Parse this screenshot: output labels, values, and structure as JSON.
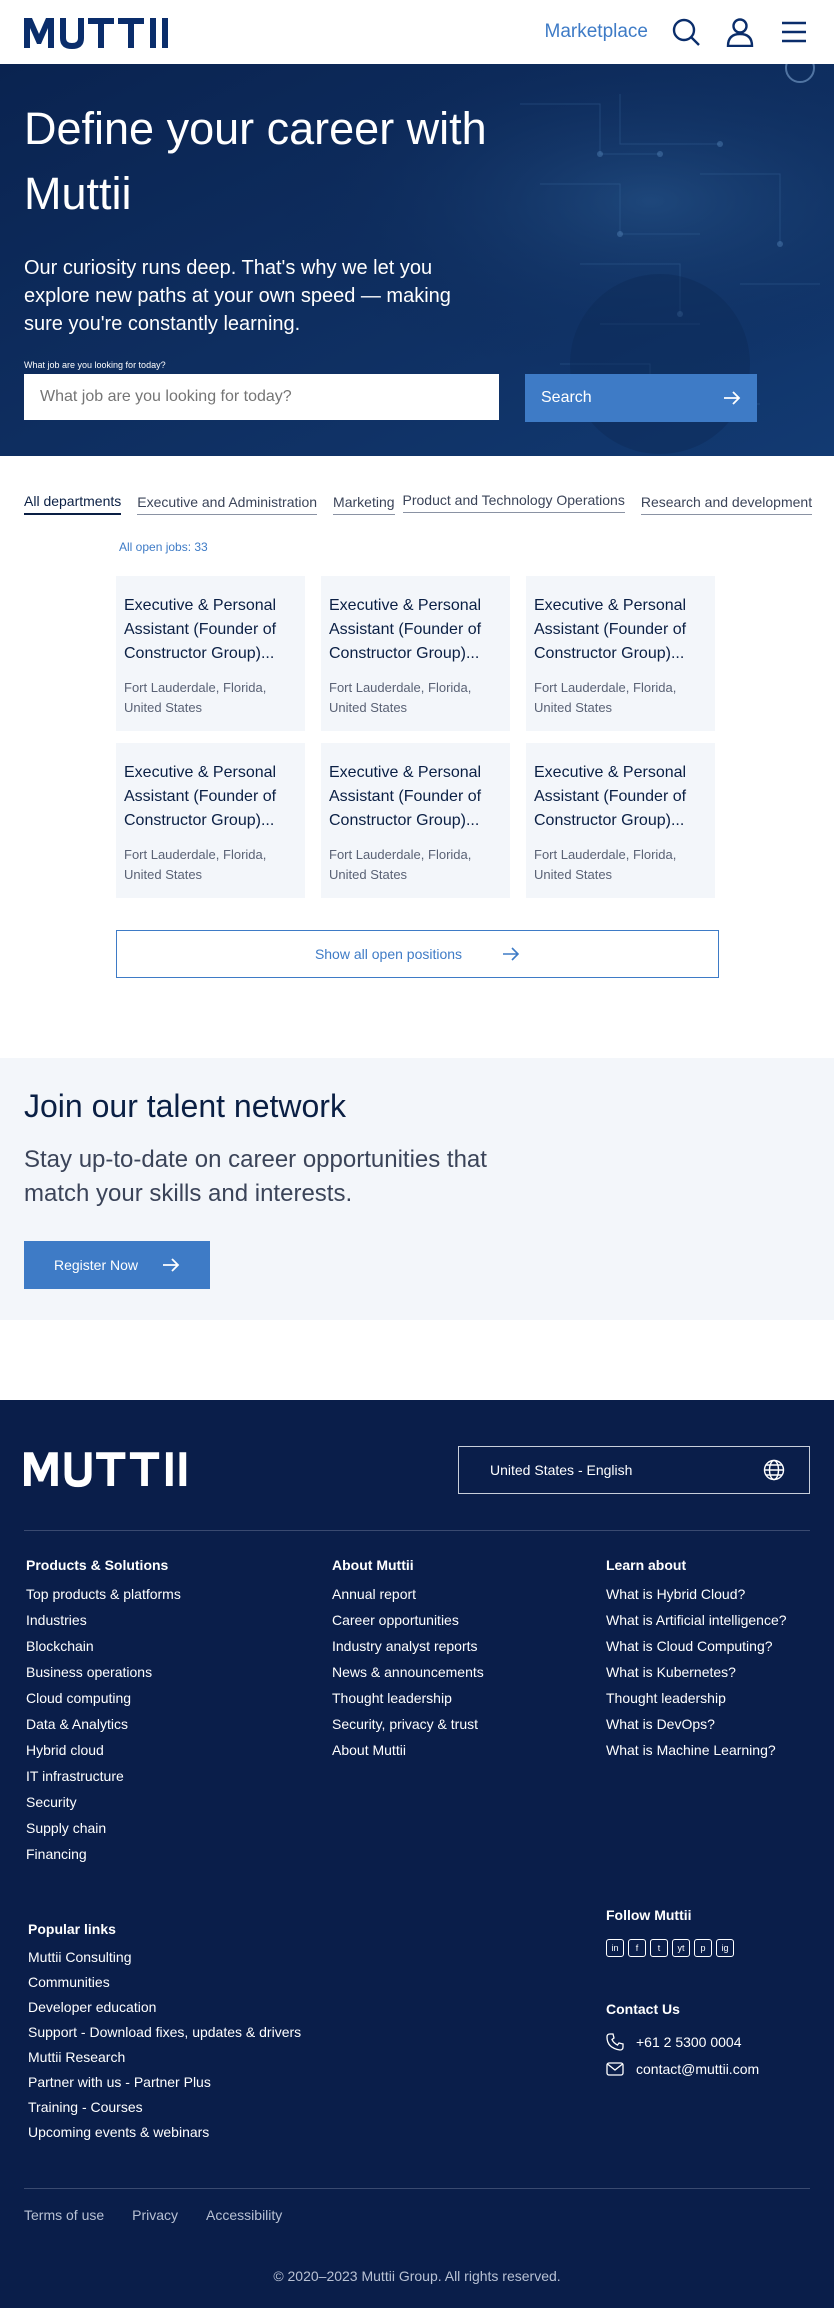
{
  "header": {
    "logo_text": "MUTTII",
    "marketplace": "Marketplace"
  },
  "hero": {
    "title": "Define your career with Muttii",
    "subtitle": "Our curiosity runs deep. That's why we let you explore new paths at your own speed — making sure you're constantly learning.",
    "search_label": "What job are you looking for today?",
    "search_placeholder": "What job are you looking for today?",
    "search_button": "Search"
  },
  "departments": [
    "All departments",
    "Executive and Administration",
    "Marketing",
    "Product and Technology Operations",
    "Research and development"
  ],
  "jobs": {
    "count_label": "All open jobs: 33",
    "items": [
      {
        "title": "Executive & Personal Assistant (Founder of Constructor Group)...",
        "location": "Fort Lauderdale, Florida, United States"
      },
      {
        "title": "Executive & Personal Assistant (Founder of Constructor Group)...",
        "location": "Fort Lauderdale, Florida, United States"
      },
      {
        "title": "Executive & Personal Assistant (Founder of Constructor Group)...",
        "location": "Fort Lauderdale, Florida, United States"
      },
      {
        "title": "Executive & Personal Assistant (Founder of Constructor Group)...",
        "location": "Fort Lauderdale, Florida, United States"
      },
      {
        "title": "Executive & Personal Assistant (Founder of Constructor Group)...",
        "location": "Fort Lauderdale, Florida, United States"
      },
      {
        "title": "Executive & Personal Assistant (Founder of Constructor Group)...",
        "location": "Fort Lauderdale, Florida, United States"
      }
    ],
    "show_all": "Show all open positions"
  },
  "talent": {
    "title": "Join our talent network",
    "text": "Stay up-to-date on career opportunities that match your skills and interests.",
    "button": "Register Now"
  },
  "footer": {
    "language": "United States - English",
    "products": {
      "title": "Products & Solutions",
      "links": [
        "Top products & platforms",
        "Industries",
        "Blockchain",
        "Business operations",
        "Cloud computing",
        "Data & Analytics",
        "Hybrid cloud",
        "IT infrastructure",
        "Security",
        "Supply chain",
        "Financing"
      ]
    },
    "about": {
      "title": "About Muttii",
      "links": [
        "Annual report",
        "Career opportunities",
        "Industry analyst reports",
        "News & announcements",
        "Thought leadership",
        "Security, privacy & trust",
        "About Muttii"
      ]
    },
    "learn": {
      "title": "Learn about",
      "links": [
        "What is Hybrid Cloud?",
        "What is Artificial intelligence?",
        "What is Cloud Computing?",
        "What is Kubernetes?",
        "Thought leadership",
        "What is DevOps?",
        "What is Machine Learning?"
      ]
    },
    "popular": {
      "title": "Popular links",
      "links": [
        "Muttii Consulting",
        "Communities",
        "Developer education",
        "Support - Download fixes, updates & drivers",
        "Muttii Research",
        "Partner with us - Partner Plus",
        "Training - Courses",
        "Upcoming events & webinars"
      ]
    },
    "follow_title": "Follow Muttii",
    "social": [
      "in",
      "f",
      "t",
      "yt",
      "p",
      "ig"
    ],
    "contact_title": "Contact Us",
    "phone": "+61 2 5300 0004",
    "email": "contact@muttii.com",
    "bottom_links": [
      "Terms of use",
      "Privacy",
      "Accessibility"
    ],
    "copyright": "© 2020–2023 Muttii Group. All rights reserved."
  },
  "colors": {
    "brand_blue": "#3e7bc6",
    "navy": "#0a1e4a",
    "card_bg": "#f3f6fa"
  }
}
